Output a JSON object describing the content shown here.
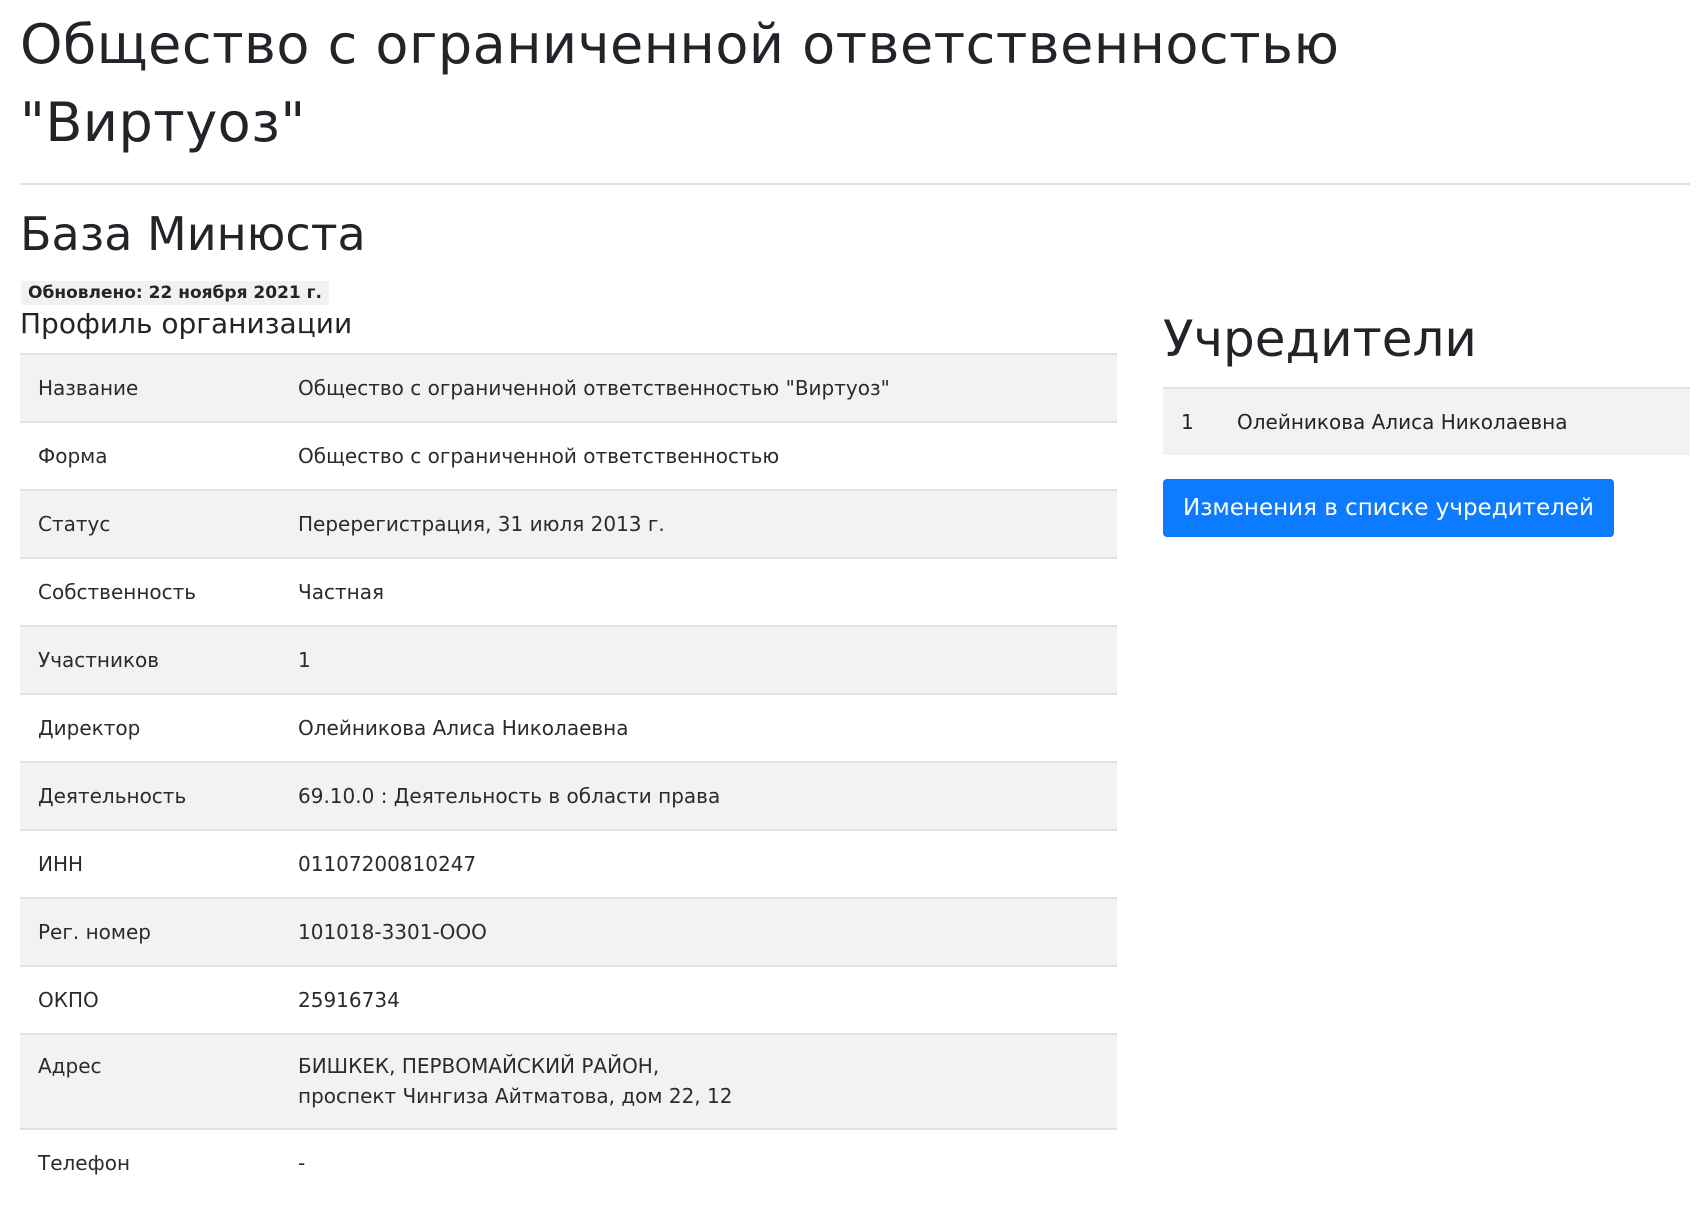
{
  "header": {
    "title": "Общество с ограниченной ответственностью \"Виртуоз\""
  },
  "section": {
    "title": "База Минюста"
  },
  "updated": {
    "text": "Обновлено: 22 ноября 2021 г."
  },
  "profile": {
    "title": "Профиль организации",
    "rows": [
      {
        "label": "Название",
        "value": "Общество с ограниченной ответственностью \"Виртуоз\""
      },
      {
        "label": "Форма",
        "value": "Общество с ограниченной ответственностью"
      },
      {
        "label": "Статус",
        "value": "Перерегистрация, 31 июля 2013 г."
      },
      {
        "label": "Собственность",
        "value": "Частная"
      },
      {
        "label": "Участников",
        "value": "1"
      },
      {
        "label": "Директор",
        "value": "Олейникова Алиса Николаевна"
      },
      {
        "label": "Деятельность",
        "value": "69.10.0 : Деятельность в области права"
      },
      {
        "label": "ИНН",
        "value": "01107200810247"
      },
      {
        "label": "Рег. номер",
        "value": "101018-3301-ООО"
      },
      {
        "label": "ОКПО",
        "value": "25916734"
      },
      {
        "label": "Адрес",
        "value_line1": "БИШКЕК, ПЕРВОМАЙСКИЙ РАЙОН,",
        "value_line2": "проспект Чингиза Айтматова, дом 22, 12"
      },
      {
        "label": "Телефон",
        "value": "-"
      }
    ]
  },
  "founders": {
    "title": "Учредители",
    "items": [
      {
        "num": "1",
        "name": "Олейникова Алиса Николаевна"
      }
    ],
    "changes_button": "Изменения в списке учредителей"
  }
}
